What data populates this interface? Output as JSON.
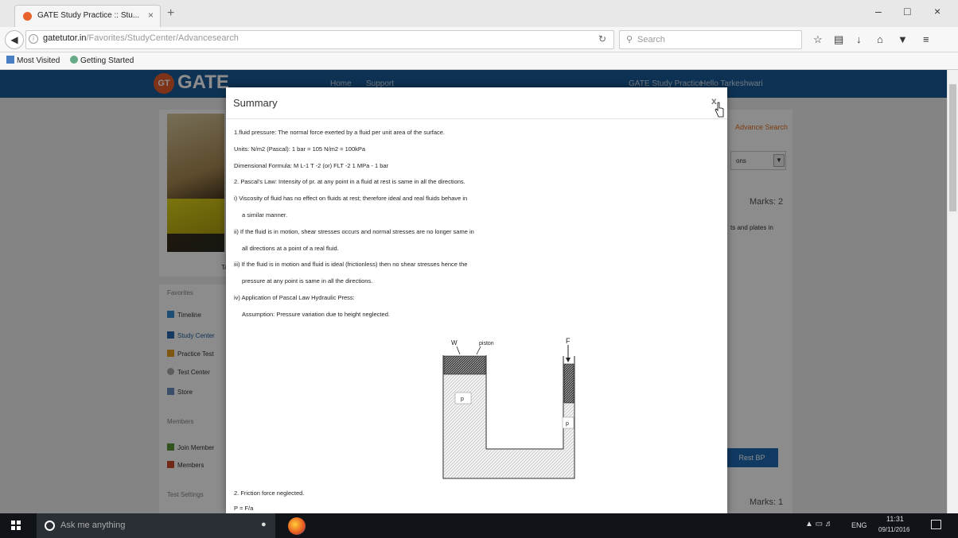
{
  "browser": {
    "tab_title": "GATE Study Practice :: Stu...",
    "tab_close": "×",
    "new_tab": "+",
    "url_domain": "gatetutor.in",
    "url_path": "/Favorites/StudyCenter/Advancesearch",
    "search_placeholder": "Search",
    "bookmarks": [
      "Most Visited",
      "Getting Started"
    ],
    "window_controls": [
      "–",
      "□",
      "×"
    ]
  },
  "site": {
    "logo_badge": "GT",
    "logo_text": "GATE",
    "nav": [
      "Home",
      "Support",
      "GATE Study Practice",
      "Hello Tarkeshwari"
    ],
    "profile_name": "Tarl",
    "favorites_heading": "Favorites",
    "favorites": [
      "Timeline",
      "Study Center",
      "Practice Test",
      "Test Center",
      "Store"
    ],
    "members_heading": "Members",
    "members": [
      "Join Member",
      "Members"
    ],
    "test_settings_heading": "Test Settings",
    "right_advance_search": "Advance Search",
    "right_select_value": "ons",
    "right_marks_1": "Marks: 2",
    "right_snippet": "ts and plates in",
    "right_button": "Rest BP",
    "right_marks_2": "Marks: 1"
  },
  "modal": {
    "title": "Summary",
    "close": "x",
    "lines": [
      "1.fluid pressure: The normal force exerted by a fluid per unit area of the surface.",
      "Units: N/m2 (Pascal): 1 bar = 105 N/m2 = 100kPa",
      "Dimensional Formula: M L-1 T -2  (or) FLT -2        1 MPa - 1 bar",
      "2. Pascal's Law: Intensity of pr. at any point in a fluid at rest is same in all the directions.",
      "i) Viscosity of fluid has no effect on fluids at rest; therefore ideal and real fluids behave in",
      "a similar manner.",
      "ii) If the fluid is in motion, shear stresses occurs and normal stresses are no longer same in",
      "all directions at a point of a real fluid.",
      "iii) If the fluid is in motion and fluid is ideal (frictionless) then no shear stresses hence the",
      "pressure at any point is same in all the directions.",
      "iv) Application of Pascal Law Hydraulic Press:",
      "Assumption: Pressure variation due to height neglected."
    ],
    "after_lines": [
      "2. Friction force neglected.",
      "P = F/a"
    ],
    "diagram_labels": {
      "weight": "W",
      "piston": "piston",
      "force": "F",
      "pressure_left": "p",
      "pressure_right": "p"
    }
  },
  "taskbar": {
    "search_placeholder": "Ask me anything",
    "language": "ENG",
    "time": "11:31",
    "date": "09/11/2016"
  }
}
